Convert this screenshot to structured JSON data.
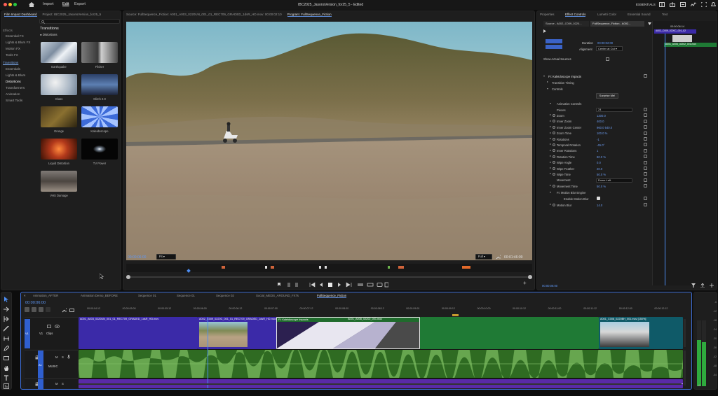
{
  "window": {
    "app_menu": [
      "Import",
      "Edit",
      "Export"
    ],
    "active_menu": "Edit",
    "title": "IBC2025_JasonsVersion_for25_5 - Edited",
    "workspace": "ESSENTIALS"
  },
  "effects_panel": {
    "tabs": [
      "Film Impact Dashboard",
      "Project: IBC2025_JasonsVersion_for25_5"
    ],
    "categories_title": "Effects",
    "categories": [
      "Essential FX",
      "Lights & Blurs FX",
      "Motion FX",
      "Tools FX"
    ],
    "transitions_title": "Transitions",
    "transition_categories": [
      "Essentials",
      "Lights & Blurs",
      "Distortions",
      "Transformers",
      "Animation",
      "Smart Tools"
    ],
    "selected_category": "Distortions",
    "header": "Transitions",
    "subheader": "Distortions",
    "thumbnails": [
      "Earthquake",
      "Flicker",
      "Glass",
      "Glitch 2.0",
      "Grunge",
      "Kaleidoscope",
      "Liquid Distortion",
      "TV Power",
      "VHS Damage"
    ]
  },
  "source_monitor": {
    "label": "Source: FullSequence_Fiction: A001_A003_0220UN_001_01_REC709_GRADED_1dsR_HD.mov: 00:00:02:10"
  },
  "program_monitor": {
    "label": "Program: FullSequence_Fiction",
    "timecode": "00:00:06:00",
    "fit": "Fit",
    "quality": "Full",
    "duration": "00:01:46:09"
  },
  "effect_controls": {
    "tabs": [
      "Properties",
      "Effect Controls",
      "Lumetri Color",
      "Essential Sound",
      "Text"
    ],
    "active_tab": "Effect Controls",
    "source_tab": "Source - A002_C009_0220...",
    "sequence_tab": "FullSequence_Fiction - A002...",
    "duration_label": "Duration",
    "duration_value": "00:00:02:00",
    "alignment_label": "Alignment",
    "alignment_value": "Center at Cut",
    "show_actual_sources": "Show Actual Sources",
    "effect_name": "FI: Kaleidoscope Impacts",
    "transition_timing": "Transition Timing",
    "controls": "Controls",
    "surprise_button": "Surprise Me!",
    "animation_controls": "Animation Controls",
    "params": [
      {
        "name": "Pieces",
        "value": "24",
        "type": "dropdown"
      },
      {
        "name": "Zoom",
        "value": "1200.0"
      },
      {
        "name": "Inner Zoom",
        "value": "400.0"
      },
      {
        "name": "Inner Zoom Center",
        "value": "960.0    540.0"
      },
      {
        "name": "Zoom Time",
        "value": "100.0 %"
      },
      {
        "name": "Rotations",
        "value": "-1"
      },
      {
        "name": "Temporal Rotation",
        "value": "-45.0°"
      },
      {
        "name": "Inner Rotations",
        "value": "1"
      },
      {
        "name": "Rotation Time",
        "value": "80.0 %"
      },
      {
        "name": "Wipe Angle",
        "value": "0.0"
      },
      {
        "name": "Wipe Feather",
        "value": "20.0"
      },
      {
        "name": "Wipe Time",
        "value": "50.0 %"
      },
      {
        "name": "Movement",
        "value": "Down-Left",
        "type": "dropdown"
      },
      {
        "name": "Movement Time",
        "value": "50.0 %"
      }
    ],
    "motion_blur_engine": "FI: Motion Blur Engine",
    "enable_motion_blur": "Enable Motion Blur",
    "motion_blur_label": "Motion Blur",
    "motion_blur_value": "14.0",
    "footer_timecode": "00:00:06:00",
    "mini_timecode": "00:00:06:14",
    "mini_clip_a": "A002_C009_0220C_001_02",
    "mini_clip_b": "A001_A008_02202_001.mov"
  },
  "timeline": {
    "sequence_tabs": [
      "Animation_AFTER",
      "Animation Demo_BEFORE",
      "Sequence 01",
      "Sequence 01",
      "Sequence 02",
      "Social_MEDS_AROUND_FXTs",
      "FullSequence_Fiction"
    ],
    "active_sequence": "FullSequence_Fiction",
    "timecode": "00:00:06:00",
    "ruler": [
      "00:00:04:12",
      "00:00:05:00",
      "00:00:05:12",
      "00:00:06:00",
      "00:00:06:12",
      "00:00:07:00",
      "00:00:07:12",
      "00:00:08:00",
      "00:00:08:12",
      "00:00:09:00",
      "00:00:09:12",
      "00:00:10:00",
      "00:00:10:12",
      "00:00:11:00",
      "00:00:11:12",
      "00:00:12:00",
      "00:00:12:12"
    ],
    "tracks": {
      "v1": "V1",
      "v1_name": "Clips",
      "a1": "A1",
      "a1_name": "MUSIC"
    },
    "clip_a": "A001_A003_0220UN_001_01_REC709_GRADED_1dsR_HD.mov",
    "clip_b": "A002_C009_0220C_001_01_REC709_GRADED_1dsR_HD.mov",
    "transition": "FI: Kaleidoscope Impacts",
    "clip_c": "A001_A008_02202_001.mov",
    "clip_d": "A001_C008_0220BH_001.mov [150%]",
    "meter_labels": [
      "-6",
      "-12",
      "-18",
      "-24",
      "-30",
      "-36",
      "-42",
      "-48",
      "-54"
    ],
    "meter_unit": "dB"
  },
  "colors": {
    "accent": "#2f6fe0",
    "video_clip": "#3b2aa8",
    "green_clip": "#1f6b2c",
    "audio": "#2f6b22",
    "playhead": "#4d8df2"
  }
}
